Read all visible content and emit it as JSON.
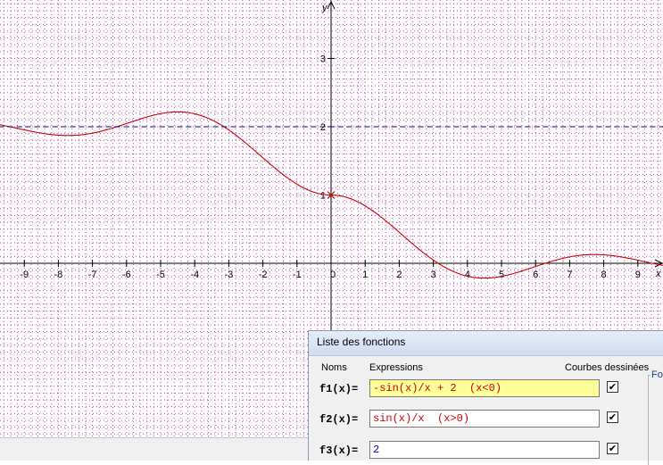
{
  "chart_data": {
    "type": "line",
    "x_axis": {
      "label": "x",
      "ticks": [
        "-9",
        "-8",
        "-7",
        "-6",
        "-5",
        "-4",
        "-3",
        "-2",
        "-1",
        "0",
        "1",
        "2",
        "3",
        "4",
        "5",
        "6",
        "7",
        "8",
        "9"
      ],
      "range": [
        -9.75,
        9.75
      ]
    },
    "y_axis": {
      "label": "y",
      "ticks": [
        "1",
        "2",
        "3"
      ],
      "range": [
        -2.85,
        3.85
      ]
    },
    "grid": true,
    "series": [
      {
        "expression": "-sin(x)/x + 2",
        "domain": "x<0",
        "color": "#cc0000",
        "style": "solid"
      },
      {
        "expression": "sin(x)/x",
        "domain": "x>0",
        "color": "#cc0000",
        "style": "solid"
      },
      {
        "expression": "2",
        "color": "#00007a",
        "style": "dashed"
      }
    ],
    "marker": {
      "x": 0,
      "y": 1,
      "symbol": "x"
    }
  },
  "dialog": {
    "title": "Liste des fonctions",
    "col_names": "Noms",
    "col_expressions": "Expressions",
    "col_drawn": "Courbes dessinées",
    "group_label": "Fo",
    "functions": [
      {
        "name": "f1(x)=",
        "expression": "-sin(x)/x + 2  (x<0)",
        "checked": "✔"
      },
      {
        "name": "f2(x)=",
        "expression": "sin(x)/x  (x>0)",
        "checked": "✔"
      },
      {
        "name": "f3(x)=",
        "expression": "2",
        "checked": "✔"
      }
    ]
  }
}
